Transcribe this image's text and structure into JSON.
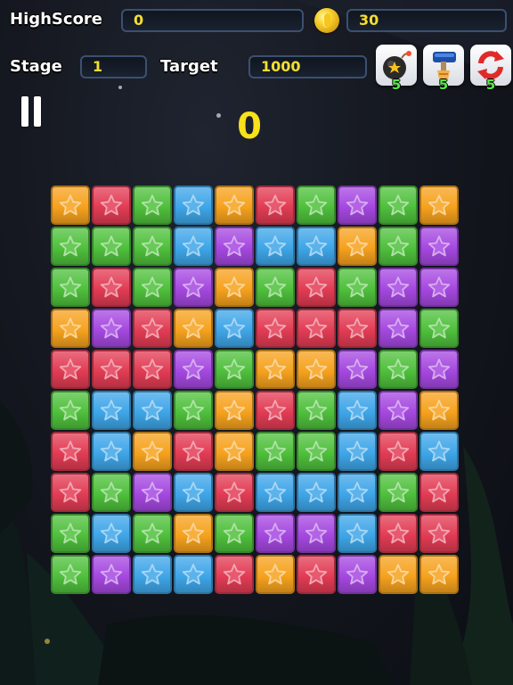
{
  "hud": {
    "highscore_label": "HighScore",
    "highscore_value": "0",
    "coins_value": "30",
    "stage_label": "Stage",
    "stage_value": "1",
    "target_label": "Target",
    "target_value": "1000",
    "current_score": "0"
  },
  "powerups": [
    {
      "name": "bomb",
      "icon": "bomb-icon",
      "count": "5"
    },
    {
      "name": "paint-brush",
      "icon": "paint-brush-icon",
      "count": "5"
    },
    {
      "name": "shuffle",
      "icon": "shuffle-icon",
      "count": "5"
    }
  ],
  "colors": {
    "orange": "#f6a21e",
    "red": "#e23c54",
    "green": "#4fc03c",
    "blue": "#3fa6e8",
    "purple": "#a548e0",
    "score_yellow": "#f7e21b",
    "count_green": "#57e84a"
  },
  "board": {
    "cols": 10,
    "rows": 10,
    "tiles": [
      [
        "orange",
        "red",
        "green",
        "blue",
        "orange",
        "red",
        "green",
        "purple",
        "green",
        "orange"
      ],
      [
        "green",
        "green",
        "green",
        "blue",
        "purple",
        "blue",
        "blue",
        "orange",
        "green",
        "purple"
      ],
      [
        "green",
        "red",
        "green",
        "purple",
        "orange",
        "green",
        "red",
        "green",
        "purple",
        "purple"
      ],
      [
        "orange",
        "purple",
        "red",
        "orange",
        "blue",
        "red",
        "red",
        "red",
        "purple",
        "green"
      ],
      [
        "red",
        "red",
        "red",
        "purple",
        "green",
        "orange",
        "orange",
        "purple",
        "green",
        "purple"
      ],
      [
        "green",
        "blue",
        "blue",
        "green",
        "orange",
        "red",
        "green",
        "blue",
        "purple",
        "orange"
      ],
      [
        "red",
        "blue",
        "orange",
        "red",
        "orange",
        "green",
        "green",
        "blue",
        "red",
        "blue"
      ],
      [
        "red",
        "green",
        "purple",
        "blue",
        "red",
        "blue",
        "blue",
        "blue",
        "green",
        "red"
      ],
      [
        "green",
        "blue",
        "green",
        "orange",
        "green",
        "purple",
        "purple",
        "blue",
        "red",
        "red"
      ],
      [
        "green",
        "purple",
        "blue",
        "blue",
        "red",
        "orange",
        "red",
        "purple",
        "orange",
        "orange"
      ]
    ]
  }
}
